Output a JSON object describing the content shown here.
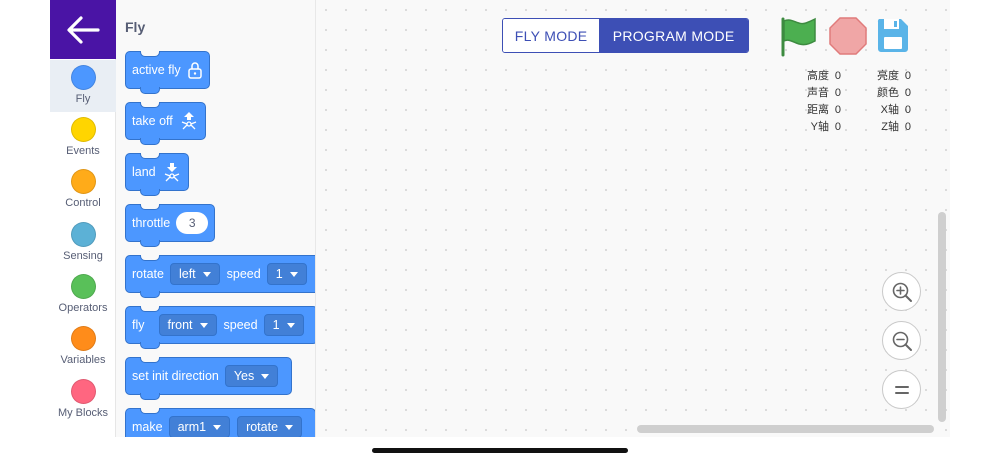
{
  "sidebar": {
    "categories": [
      {
        "label": "Fly",
        "color": "#4c97ff"
      },
      {
        "label": "Events",
        "color": "#ffd500"
      },
      {
        "label": "Control",
        "color": "#ffab19"
      },
      {
        "label": "Sensing",
        "color": "#5cb1d6"
      },
      {
        "label": "Operators",
        "color": "#59c059"
      },
      {
        "label": "Variables",
        "color": "#ff8c1a"
      },
      {
        "label": "My Blocks",
        "color": "#ff6680"
      }
    ]
  },
  "flyout": {
    "title": "Fly",
    "blocks": {
      "active_fly": "active fly",
      "take_off": "take off",
      "land": "land",
      "throttle": {
        "label": "throttle",
        "value": "3"
      },
      "rotate": {
        "label": "rotate",
        "dir": "left",
        "speed_label": "speed",
        "speed": "1"
      },
      "fly": {
        "label": "fly",
        "dir": "front",
        "speed_label": "speed",
        "speed": "1"
      },
      "set_init": {
        "label": "set init direction",
        "value": "Yes"
      },
      "make": {
        "label": "make",
        "arm": "arm1",
        "action": "rotate"
      }
    }
  },
  "header": {
    "fly_mode": "FLY MODE",
    "program_mode": "PROGRAM MODE"
  },
  "controls": {
    "flag_icon": "green-flag-icon",
    "stop_icon": "stop-icon",
    "save_icon": "save-icon"
  },
  "sensors": {
    "left": [
      {
        "label": "高度",
        "value": "0"
      },
      {
        "label": "声音",
        "value": "0"
      },
      {
        "label": "距离",
        "value": "0"
      },
      {
        "label": "Y轴",
        "value": "0"
      }
    ],
    "right": [
      {
        "label": "亮度",
        "value": "0"
      },
      {
        "label": "颜色",
        "value": "0"
      },
      {
        "label": "X轴",
        "value": "0"
      },
      {
        "label": "Z轴",
        "value": "0"
      }
    ]
  },
  "colors": {
    "accent": "#3d4fb5",
    "back_button": "#4a14a5",
    "block": "#4c97ff",
    "flag": "#4caf50",
    "stop": "#f0a6a6",
    "save": "#5ab4e8"
  }
}
